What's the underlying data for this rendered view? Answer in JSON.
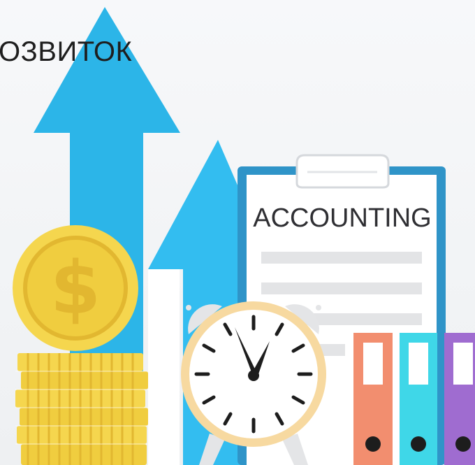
{
  "headline": "ОЗВИТОК",
  "clipboard": {
    "title": "ACCOUNTING"
  },
  "clock": {
    "hour_hand_points_to": 11,
    "minute_hand_points_to": 1
  },
  "colors": {
    "arrow": "#2cb5e8",
    "coin_gold": "#f5d64e",
    "coin_dark": "#e2b730",
    "clipboard_border": "#2f94c8",
    "binder_orange": "#f28e6f",
    "binder_cyan": "#3fd7e8",
    "binder_purple": "#9f6cd0"
  },
  "icons": [
    "up-arrow-icon",
    "dollar-coin-icon",
    "alarm-clock-icon",
    "clipboard-icon",
    "binder-icon"
  ]
}
